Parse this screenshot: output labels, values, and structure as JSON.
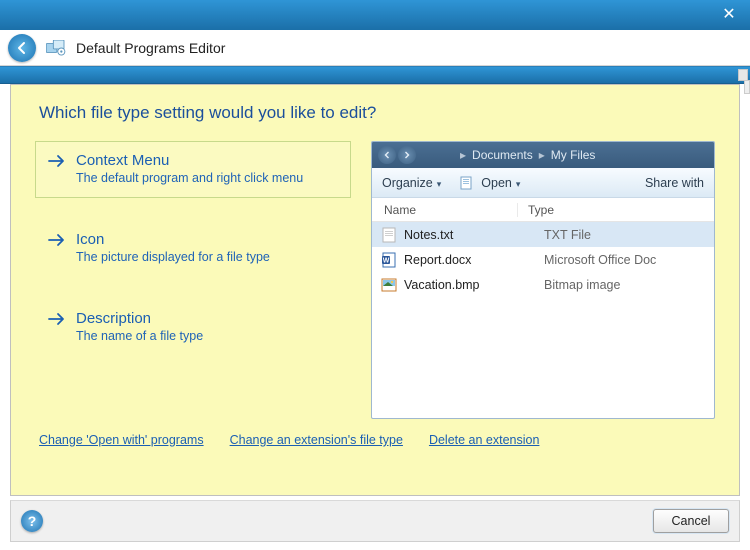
{
  "titlebar": {},
  "header": {
    "title": "Default Programs Editor"
  },
  "question": "Which file type setting would you like to edit?",
  "options": [
    {
      "title": "Context Menu",
      "subtitle": "The default program and right click menu",
      "selected": true
    },
    {
      "title": "Icon",
      "subtitle": "The picture displayed for a file type",
      "selected": false
    },
    {
      "title": "Description",
      "subtitle": "The name of a file type",
      "selected": false
    }
  ],
  "preview": {
    "breadcrumb": {
      "a": "Documents",
      "b": "My Files"
    },
    "toolbar": {
      "organize": "Organize",
      "open": "Open",
      "share": "Share with"
    },
    "columns": {
      "name": "Name",
      "type": "Type"
    },
    "rows": [
      {
        "name": "Notes.txt",
        "type": "TXT File",
        "icon": "txt",
        "selected": true
      },
      {
        "name": "Report.docx",
        "type": "Microsoft Office Doc",
        "icon": "doc",
        "selected": false
      },
      {
        "name": "Vacation.bmp",
        "type": "Bitmap image",
        "icon": "bmp",
        "selected": false
      }
    ]
  },
  "links": {
    "openwith": "Change 'Open with' programs",
    "changeext": "Change an extension's file type",
    "deleteext": "Delete an extension"
  },
  "footer": {
    "cancel": "Cancel"
  }
}
